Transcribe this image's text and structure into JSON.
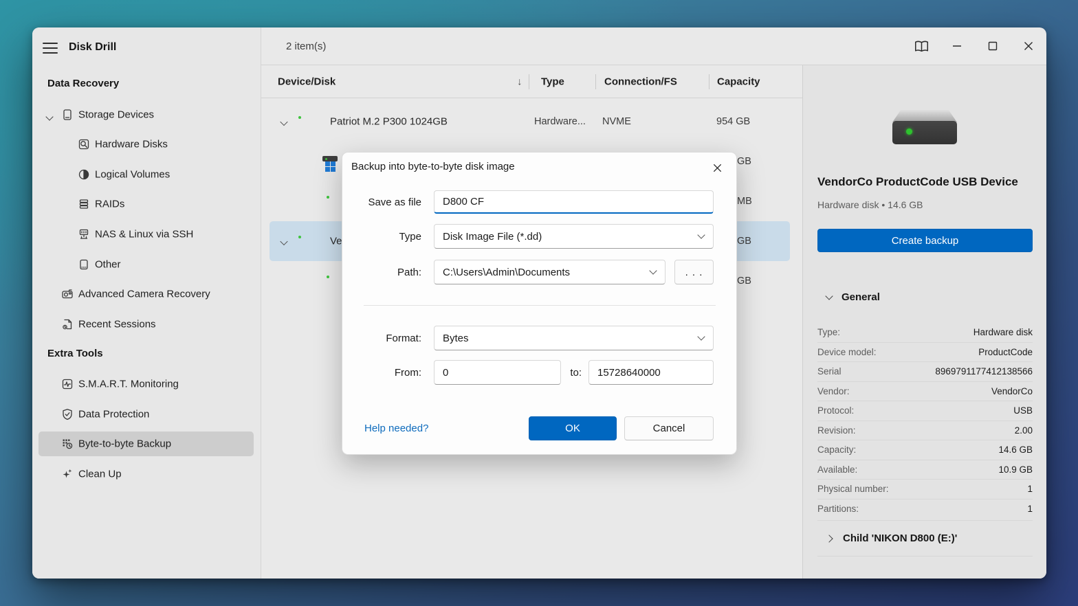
{
  "app": {
    "title": "Disk Drill",
    "items_count": "2 item(s)"
  },
  "colors": {
    "accent": "#0067C0",
    "selection_blue": "#c9dbe9",
    "link_blue": "#0f6cbd",
    "led_green": "#2ec22e",
    "window_bg": "#e9e9e9"
  },
  "titlebar": {
    "icons": [
      "open-book-icon",
      "minimize-icon",
      "maximize-icon",
      "close-icon"
    ]
  },
  "sidebar": {
    "sections": [
      {
        "title": "Data Recovery"
      },
      {
        "title": "Extra Tools"
      }
    ],
    "items": [
      {
        "label": "Storage Devices",
        "icon": "storage-devices-icon",
        "expanded": true
      },
      {
        "label": "Hardware Disks",
        "icon": "hardware-disks-icon"
      },
      {
        "label": "Logical Volumes",
        "icon": "logical-volumes-icon"
      },
      {
        "label": "RAIDs",
        "icon": "raids-icon"
      },
      {
        "label": "NAS & Linux via SSH",
        "icon": "nas-ssh-icon"
      },
      {
        "label": "Other",
        "icon": "other-disk-icon"
      },
      {
        "label": "Advanced Camera Recovery",
        "icon": "camera-icon"
      },
      {
        "label": "Recent Sessions",
        "icon": "recent-sessions-icon"
      },
      {
        "label": "S.M.A.R.T. Monitoring",
        "icon": "smart-monitoring-icon"
      },
      {
        "label": "Data Protection",
        "icon": "data-protection-icon"
      },
      {
        "label": "Byte-to-byte Backup",
        "icon": "byte-backup-icon",
        "selected": true
      },
      {
        "label": "Clean Up",
        "icon": "clean-up-icon"
      }
    ]
  },
  "table": {
    "sort_icon": "↓",
    "columns": [
      "Device/Disk",
      "Type",
      "Connection/FS",
      "Capacity"
    ],
    "rows": [
      {
        "name": "Patriot M.2 P300 1024GB",
        "type": "Hardware...",
        "fs": "NVME",
        "capacity": "954 GB",
        "expanded": true
      },
      {
        "name": "",
        "capacity": "GB"
      },
      {
        "name": "",
        "capacity": "MB"
      },
      {
        "name": "Ve",
        "capacity": "GB",
        "selected": true,
        "expanded": true
      },
      {
        "name": "",
        "capacity": "GB"
      }
    ]
  },
  "dialog": {
    "title": "Backup into byte-to-byte disk image",
    "save_as_label": "Save as file",
    "save_as_value": "D800 CF",
    "type_label": "Type",
    "type_value": "Disk Image File (*.dd)",
    "path_label": "Path:",
    "path_value": "C:\\Users\\Admin\\Documents",
    "browse_label": ". . .",
    "format_label": "Format:",
    "format_value": "Bytes",
    "from_label": "From:",
    "from_value": "0",
    "to_label": "to:",
    "to_value": "15728640000",
    "help_link": "Help needed?",
    "ok_label": "OK",
    "cancel_label": "Cancel"
  },
  "details": {
    "device_title": "VendorCo ProductCode USB Device",
    "device_subtitle": "Hardware disk • 14.6 GB",
    "create_backup_label": "Create backup",
    "general_title": "General",
    "rows": [
      {
        "label": "Type:",
        "value": "Hardware disk"
      },
      {
        "label": "Device model:",
        "value": "ProductCode"
      },
      {
        "label": "Serial",
        "value": "8969791177412138566"
      },
      {
        "label": "Vendor:",
        "value": "VendorCo"
      },
      {
        "label": "Protocol:",
        "value": "USB"
      },
      {
        "label": "Revision:",
        "value": "2.00"
      },
      {
        "label": "Capacity:",
        "value": "14.6 GB"
      },
      {
        "label": "Available:",
        "value": "10.9 GB"
      },
      {
        "label": "Physical number:",
        "value": "1"
      },
      {
        "label": "Partitions:",
        "value": "1"
      }
    ],
    "child_row": "Child 'NIKON D800 (E:)'"
  }
}
